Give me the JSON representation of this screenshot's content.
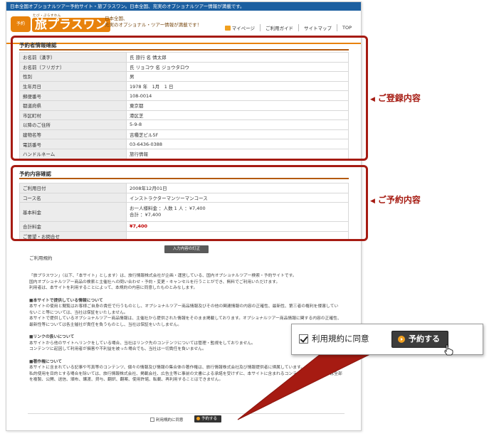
{
  "topbar": {
    "text": "日本全国オプショナルツアー予約サイト・旅プラスワン。日本全国、充実のオプショナルツアー情報が満載です。"
  },
  "header": {
    "logo_badge": "予約",
    "logo_ruby": "たび・ぷらすわん",
    "logo_text": "旅プラスワン",
    "tagline_1": "日本全国、",
    "tagline_2": "充実のオプショナル・ツアー情報が満載です！",
    "nav": [
      "マイページ",
      "ご利用ガイド",
      "サイトマップ",
      "TOP"
    ]
  },
  "reservant": {
    "title": "予約者情報確認",
    "rows": [
      {
        "label": "お名前（漢字）",
        "value": "氏 旅行 名 情太郎"
      },
      {
        "label": "お名前（フリガナ）",
        "value": "氏 リョコウ 名 ジョウタロウ"
      },
      {
        "label": "性別",
        "value": "男"
      },
      {
        "label": "生年月日",
        "value": "1978 年　1月　1 日"
      },
      {
        "label": "郵便番号",
        "value": "108-0014"
      },
      {
        "label": "都道府県",
        "value": "東京都"
      },
      {
        "label": "市区町村",
        "value": "港区芝"
      },
      {
        "label": "以降のご住所",
        "value": "5-9-8"
      },
      {
        "label": "建物名等",
        "value": "吉種芝ビル5F"
      },
      {
        "label": "電話番号",
        "value": "03-6436-0388"
      },
      {
        "label": "ハンドルネーム",
        "value": "旅行情報"
      }
    ]
  },
  "reservation": {
    "title": "予約内容確認",
    "date_label": "ご利用日付",
    "date_value": "2008年12月01日",
    "course_label": "コース名",
    "course_value": "インストラクターマンツーマンコース",
    "fee_label": "基本料金",
    "fee_line1": "お一人様料金 ：人数 1 人 ：¥7,400",
    "fee_line2": "合計 ：¥7,400",
    "total_label": "合計料金",
    "total_value": "¥7,400",
    "request_label": "ご要望・お問合せ",
    "request_value": ""
  },
  "annotations": {
    "registration": "ご登録内容",
    "reservation": "ご予約内容"
  },
  "fix_button": "入力内容の訂正",
  "terms": {
    "title": "ご利用規約",
    "p1": "「旅プラスワン」（以下、「本サイト」とします）は、旅行情報株式会社が企画・運営している、国内オプショナルツアー検索・予約サイトです。",
    "p2": "国内オプショナルツアー商品の検索と主催社への問い合わせ・予約・変更・キャンセルを行うことができ、無料でご利用いただけます。",
    "p3": "利用者は、本サイトを利用することによって、本規約の内容に同意したものとみなします。",
    "h1": "■本サイトで提供している情報について",
    "p4": "本サイトの使用と閲覧はお客様ご自身の責任で行うものとし、オプショナルツアー商品情報及びその他の関連情報の内容の正確性、最新性、第三者の権利を侵害していないこと等については、当社は保証をいたしません。",
    "p5": "本サイトで提供しているオプショナルツアー商品情報は、主催社から提供された情報をそのまま掲載しております。オプショナルツアー商品情報に関する内容の正確性、最新性等については各主催社が責任を負うものとし、当社は保証をいたしません。",
    "h2": "■リンクの扱いについて",
    "p6": "本サイトから他のサイトへリンクをしている場合、当社はリンク先のコンテンツについては管理・監視をしておりません。",
    "p7": "コンテンツに起因して利用者が損害や不利益を被った場合でも、当社は一切責任を負いません。",
    "h3": "■著作権について",
    "p8": "本サイトに含まれている記事や写真等のコンテンツ、個々の情報及び情報の集合体の著作権は、旅行情報株式会社及び情報提供者に帰属しています。",
    "p9": "私的使用を目的とする場合を除いては、旅行情報株式会社、掲載会社、広告主等に事前の文書による承諾を受けずに、本サイトに含まれるコンテンツの一部あるいは全部を複製、公開、送信、頒布、譲渡、貸与、翻訳、翻案、使用許諾、転載、再利用することはできません。"
  },
  "bottom": {
    "agree": "利用規約に同意",
    "reserve": "予約する"
  },
  "callout": {
    "agree": "利用規約に同意",
    "reserve": "予約する"
  },
  "colors": {
    "accent": "#e8820c",
    "annotation": "#a61b12",
    "topbar": "#1c5fa0"
  }
}
